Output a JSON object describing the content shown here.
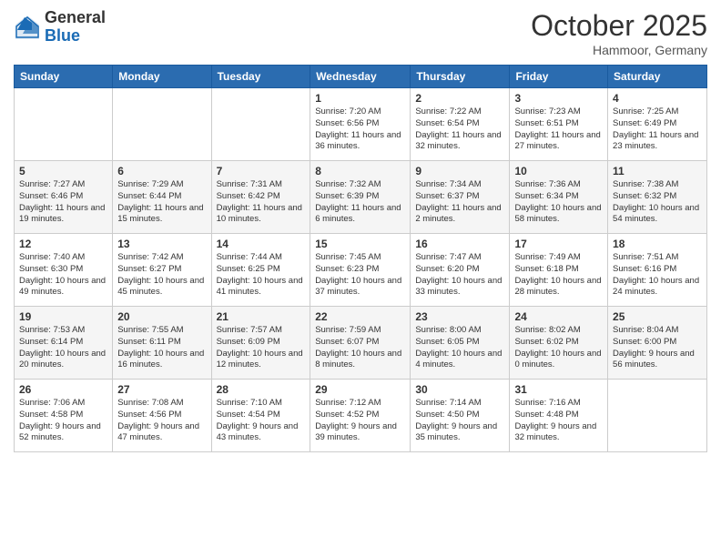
{
  "logo": {
    "general": "General",
    "blue": "Blue"
  },
  "title": "October 2025",
  "location": "Hammoor, Germany",
  "headers": [
    "Sunday",
    "Monday",
    "Tuesday",
    "Wednesday",
    "Thursday",
    "Friday",
    "Saturday"
  ],
  "weeks": [
    [
      {
        "day": "",
        "info": ""
      },
      {
        "day": "",
        "info": ""
      },
      {
        "day": "",
        "info": ""
      },
      {
        "day": "1",
        "info": "Sunrise: 7:20 AM\nSunset: 6:56 PM\nDaylight: 11 hours and 36 minutes."
      },
      {
        "day": "2",
        "info": "Sunrise: 7:22 AM\nSunset: 6:54 PM\nDaylight: 11 hours and 32 minutes."
      },
      {
        "day": "3",
        "info": "Sunrise: 7:23 AM\nSunset: 6:51 PM\nDaylight: 11 hours and 27 minutes."
      },
      {
        "day": "4",
        "info": "Sunrise: 7:25 AM\nSunset: 6:49 PM\nDaylight: 11 hours and 23 minutes."
      }
    ],
    [
      {
        "day": "5",
        "info": "Sunrise: 7:27 AM\nSunset: 6:46 PM\nDaylight: 11 hours and 19 minutes."
      },
      {
        "day": "6",
        "info": "Sunrise: 7:29 AM\nSunset: 6:44 PM\nDaylight: 11 hours and 15 minutes."
      },
      {
        "day": "7",
        "info": "Sunrise: 7:31 AM\nSunset: 6:42 PM\nDaylight: 11 hours and 10 minutes."
      },
      {
        "day": "8",
        "info": "Sunrise: 7:32 AM\nSunset: 6:39 PM\nDaylight: 11 hours and 6 minutes."
      },
      {
        "day": "9",
        "info": "Sunrise: 7:34 AM\nSunset: 6:37 PM\nDaylight: 11 hours and 2 minutes."
      },
      {
        "day": "10",
        "info": "Sunrise: 7:36 AM\nSunset: 6:34 PM\nDaylight: 10 hours and 58 minutes."
      },
      {
        "day": "11",
        "info": "Sunrise: 7:38 AM\nSunset: 6:32 PM\nDaylight: 10 hours and 54 minutes."
      }
    ],
    [
      {
        "day": "12",
        "info": "Sunrise: 7:40 AM\nSunset: 6:30 PM\nDaylight: 10 hours and 49 minutes."
      },
      {
        "day": "13",
        "info": "Sunrise: 7:42 AM\nSunset: 6:27 PM\nDaylight: 10 hours and 45 minutes."
      },
      {
        "day": "14",
        "info": "Sunrise: 7:44 AM\nSunset: 6:25 PM\nDaylight: 10 hours and 41 minutes."
      },
      {
        "day": "15",
        "info": "Sunrise: 7:45 AM\nSunset: 6:23 PM\nDaylight: 10 hours and 37 minutes."
      },
      {
        "day": "16",
        "info": "Sunrise: 7:47 AM\nSunset: 6:20 PM\nDaylight: 10 hours and 33 minutes."
      },
      {
        "day": "17",
        "info": "Sunrise: 7:49 AM\nSunset: 6:18 PM\nDaylight: 10 hours and 28 minutes."
      },
      {
        "day": "18",
        "info": "Sunrise: 7:51 AM\nSunset: 6:16 PM\nDaylight: 10 hours and 24 minutes."
      }
    ],
    [
      {
        "day": "19",
        "info": "Sunrise: 7:53 AM\nSunset: 6:14 PM\nDaylight: 10 hours and 20 minutes."
      },
      {
        "day": "20",
        "info": "Sunrise: 7:55 AM\nSunset: 6:11 PM\nDaylight: 10 hours and 16 minutes."
      },
      {
        "day": "21",
        "info": "Sunrise: 7:57 AM\nSunset: 6:09 PM\nDaylight: 10 hours and 12 minutes."
      },
      {
        "day": "22",
        "info": "Sunrise: 7:59 AM\nSunset: 6:07 PM\nDaylight: 10 hours and 8 minutes."
      },
      {
        "day": "23",
        "info": "Sunrise: 8:00 AM\nSunset: 6:05 PM\nDaylight: 10 hours and 4 minutes."
      },
      {
        "day": "24",
        "info": "Sunrise: 8:02 AM\nSunset: 6:02 PM\nDaylight: 10 hours and 0 minutes."
      },
      {
        "day": "25",
        "info": "Sunrise: 8:04 AM\nSunset: 6:00 PM\nDaylight: 9 hours and 56 minutes."
      }
    ],
    [
      {
        "day": "26",
        "info": "Sunrise: 7:06 AM\nSunset: 4:58 PM\nDaylight: 9 hours and 52 minutes."
      },
      {
        "day": "27",
        "info": "Sunrise: 7:08 AM\nSunset: 4:56 PM\nDaylight: 9 hours and 47 minutes."
      },
      {
        "day": "28",
        "info": "Sunrise: 7:10 AM\nSunset: 4:54 PM\nDaylight: 9 hours and 43 minutes."
      },
      {
        "day": "29",
        "info": "Sunrise: 7:12 AM\nSunset: 4:52 PM\nDaylight: 9 hours and 39 minutes."
      },
      {
        "day": "30",
        "info": "Sunrise: 7:14 AM\nSunset: 4:50 PM\nDaylight: 9 hours and 35 minutes."
      },
      {
        "day": "31",
        "info": "Sunrise: 7:16 AM\nSunset: 4:48 PM\nDaylight: 9 hours and 32 minutes."
      },
      {
        "day": "",
        "info": ""
      }
    ]
  ]
}
